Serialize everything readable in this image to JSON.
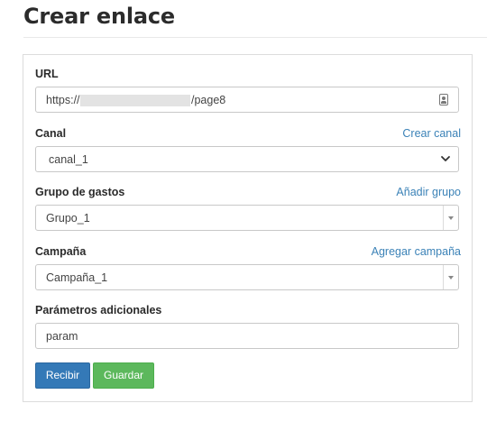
{
  "page": {
    "title": "Crear enlace"
  },
  "form": {
    "url": {
      "label": "URL",
      "prefix": "https://",
      "suffix": "/page8",
      "icon": "contact-card-icon"
    },
    "canal": {
      "label": "Canal",
      "link": "Crear canal",
      "value": "canal_1"
    },
    "grupo": {
      "label": "Grupo de gastos",
      "link": "Añadir grupo",
      "value": "Grupo_1"
    },
    "campana": {
      "label": "Campaña",
      "link": "Agregar campaña",
      "value": "Campaña_1"
    },
    "parametros": {
      "label": "Parámetros adicionales",
      "value": "param"
    }
  },
  "buttons": {
    "recibir": "Recibir",
    "guardar": "Guardar"
  },
  "colors": {
    "link": "#3b82b7",
    "primary": "#3479b7",
    "success": "#5cb85c"
  }
}
